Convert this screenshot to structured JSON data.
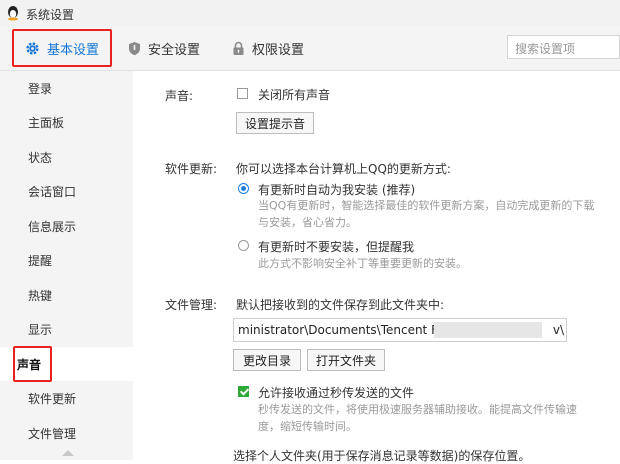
{
  "window": {
    "title": "系统设置"
  },
  "tabs": [
    {
      "label": "基本设置",
      "active": true
    },
    {
      "label": "安全设置"
    },
    {
      "label": "权限设置"
    }
  ],
  "search": {
    "placeholder": "搜索设置项"
  },
  "sidebar": {
    "items": [
      {
        "label": "登录"
      },
      {
        "label": "主面板"
      },
      {
        "label": "状态"
      },
      {
        "label": "会话窗口"
      },
      {
        "label": "信息展示"
      },
      {
        "label": "提醒"
      },
      {
        "label": "热键"
      },
      {
        "label": "显示"
      },
      {
        "label": "声音",
        "active": true
      },
      {
        "label": "软件更新"
      },
      {
        "label": "文件管理"
      }
    ]
  },
  "sound": {
    "section_label": "声音:",
    "mute_all_label": "关闭所有声音",
    "mute_all_checked": false,
    "set_tone_button": "设置提示音"
  },
  "update": {
    "section_label": "软件更新:",
    "prompt": "你可以选择本台计算机上QQ的更新方式:",
    "option_auto_label": "有更新时自动为我安装 (推荐)",
    "option_auto_desc_1": "当QQ有更新时，智能选择最佳的软件更新方案，自动完成更新的下载",
    "option_auto_desc_2": "与安装，省心省力。",
    "option_notify_label": "有更新时不要安装，但提醒我",
    "option_notify_desc": "此方式不影响安全补丁等重要更新的安装。",
    "selected": "auto"
  },
  "files": {
    "section_label": "文件管理:",
    "prompt": "默认把接收到的文件保存到此文件夹中:",
    "path_start": "ministrator\\Documents\\Tencent File",
    "path_end": "v\\",
    "change_dir_button": "更改目录",
    "open_folder_button": "打开文件夹",
    "allow_fast_label": "允许接收通过秒传发送的文件",
    "allow_fast_checked": true,
    "allow_fast_desc_1": "秒传发送的文件，将使用极速服务器辅助接收。能提高文件传输速",
    "allow_fast_desc_2": "度，缩短传输时间。",
    "personal_folder_prompt": "选择个人文件夹(用于保存消息记录等数据)的保存位置。"
  },
  "colors": {
    "accent_blue": "#1476d6",
    "highlight_red": "#e8231f",
    "check_green": "#2ea836"
  }
}
